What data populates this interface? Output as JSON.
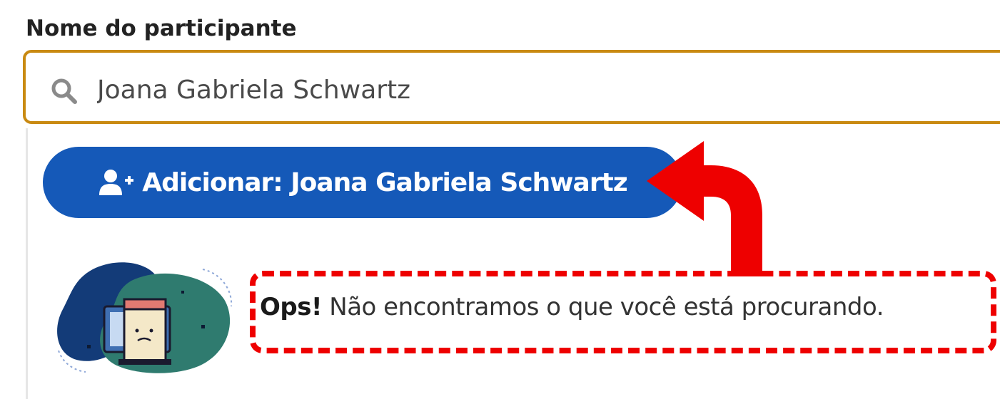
{
  "form": {
    "field_label": "Nome do participante",
    "search_value": "Joana Gabriela Schwartz"
  },
  "dropdown": {
    "add_button_label": "Adicionar: Joana Gabriela Schwartz",
    "empty_state": {
      "emphasis": "Ops!",
      "message": " Não encontramos o que você está procurando."
    }
  },
  "annotation": {
    "color": "#ee0000"
  },
  "colors": {
    "accent_border": "#c98a12",
    "button_blue": "#1559b8"
  },
  "icons": {
    "search": "search-icon",
    "add_user": "user-plus-icon",
    "illustration": "empty-search-illustration"
  }
}
